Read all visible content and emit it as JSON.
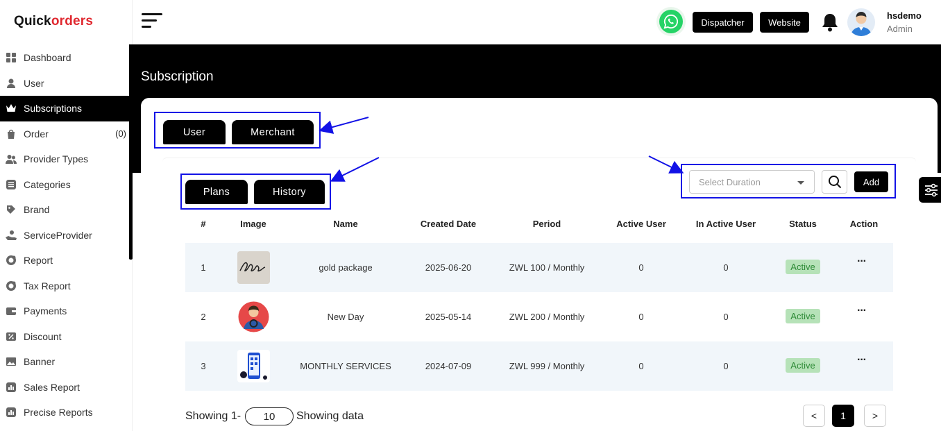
{
  "logo": {
    "part1": "Quick",
    "part2": "orders"
  },
  "sidebar": {
    "items": [
      {
        "label": "Dashboard",
        "icon": "dashboard-icon"
      },
      {
        "label": "User",
        "icon": "user-icon"
      },
      {
        "label": "Subscriptions",
        "icon": "crown-icon",
        "active": true
      },
      {
        "label": "Order",
        "icon": "shopping-bag-icon",
        "count": "(0)"
      },
      {
        "label": "Provider Types",
        "icon": "users-icon"
      },
      {
        "label": "Categories",
        "icon": "list-icon"
      },
      {
        "label": "Brand",
        "icon": "tag-icon"
      },
      {
        "label": "ServiceProvider",
        "icon": "hand-icon"
      },
      {
        "label": "Report",
        "icon": "report-icon"
      },
      {
        "label": "Tax Report",
        "icon": "tax-report-icon"
      },
      {
        "label": "Payments",
        "icon": "wallet-icon"
      },
      {
        "label": "Discount",
        "icon": "discount-icon"
      },
      {
        "label": "Banner",
        "icon": "image-icon"
      },
      {
        "label": "Sales Report",
        "icon": "chart-icon"
      },
      {
        "label": "Precise Reports",
        "icon": "precise-report-icon"
      }
    ]
  },
  "header": {
    "dispatcher": "Dispatcher",
    "website": "Website",
    "username": "hsdemo",
    "role": "Admin"
  },
  "page": {
    "title": "Subscription"
  },
  "tabs": {
    "user": "User",
    "merchant": "Merchant",
    "plans": "Plans",
    "history": "History"
  },
  "filters": {
    "duration_placeholder": "Select Duration",
    "add": "Add"
  },
  "table": {
    "headers": [
      "#",
      "Image",
      "Name",
      "Created Date",
      "Period",
      "Active User",
      "In Active User",
      "Status",
      "Action"
    ],
    "rows": [
      {
        "no": "1",
        "name": "gold package",
        "created": "2025-06-20",
        "period": "ZWL 100 / Monthly",
        "active": "0",
        "inactive": "0",
        "status": "Active",
        "image": "signature-image"
      },
      {
        "no": "2",
        "name": "New Day",
        "created": "2025-05-14",
        "period": "ZWL 200 / Monthly",
        "active": "0",
        "inactive": "0",
        "status": "Active",
        "image": "driver-avatar-image"
      },
      {
        "no": "3",
        "name": "MONTHLY SERVICES",
        "created": "2024-07-09",
        "period": "ZWL 999 / Monthly",
        "active": "0",
        "inactive": "0",
        "status": "Active",
        "image": "phone-illustration-image"
      }
    ]
  },
  "footer": {
    "showing_prefix": "Showing 1-",
    "page_size": "10",
    "showing_suffix": "Showing data",
    "prev": "<",
    "page": "1",
    "next": ">"
  },
  "colors": {
    "accent": "#000000",
    "highlight": "#1212e6",
    "status_bg": "#b6e2b8",
    "status_text": "#2d8a36",
    "row_alt": "#f1f6fa"
  }
}
